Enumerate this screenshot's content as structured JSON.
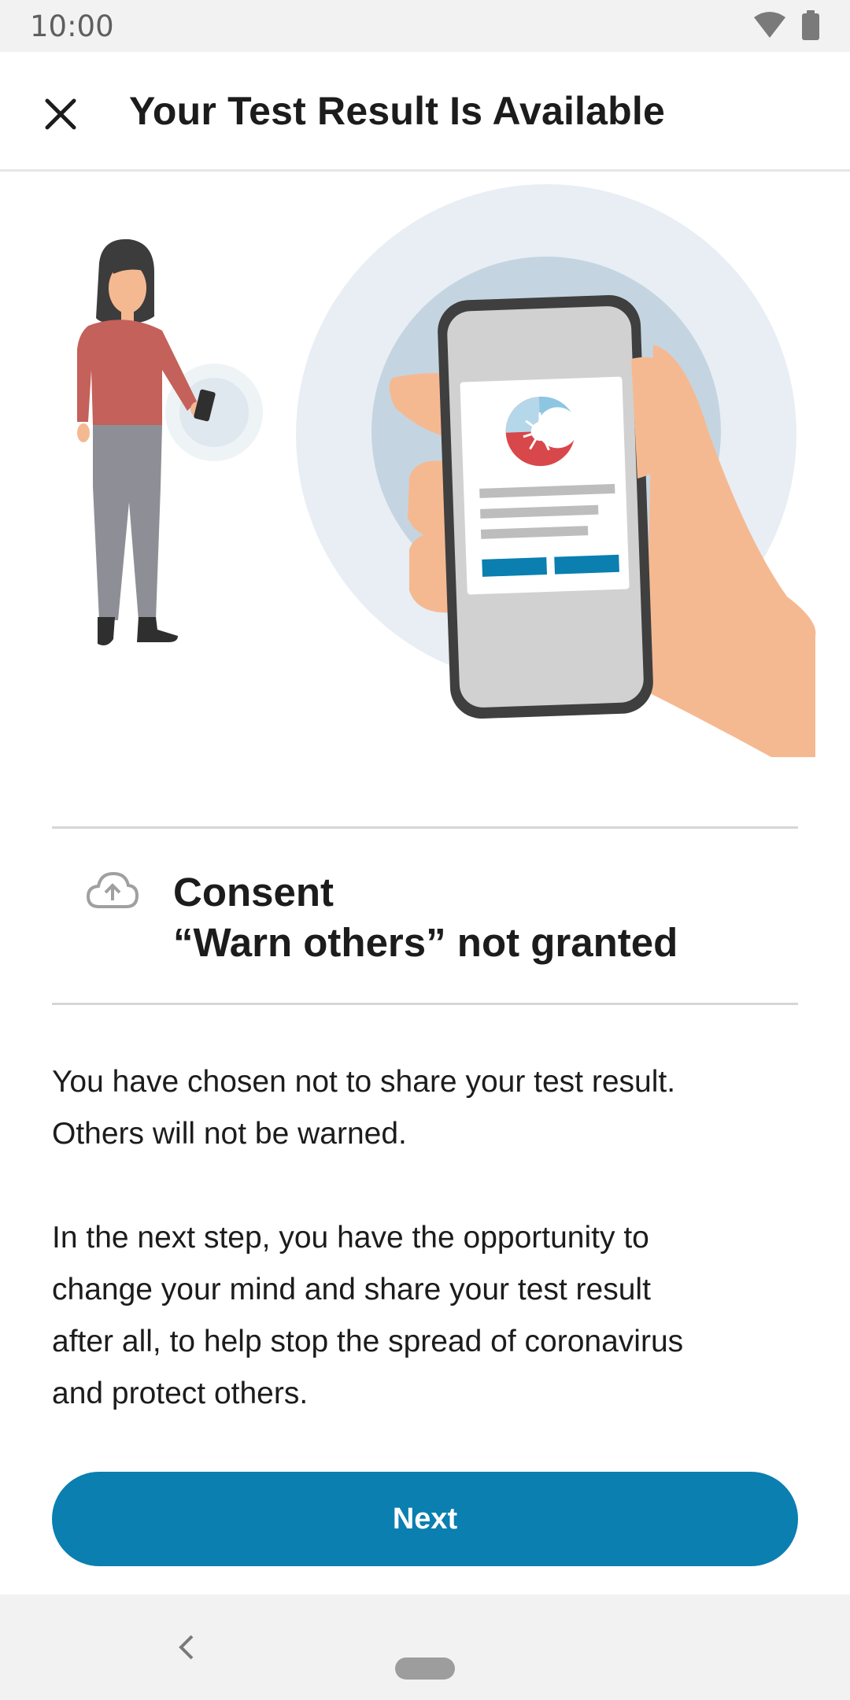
{
  "status_bar": {
    "time": "10:00",
    "icons": [
      "wifi-icon",
      "battery-icon"
    ]
  },
  "app_bar": {
    "close_icon": "close-icon",
    "title": "Your Test Result Is Available"
  },
  "consent": {
    "icon": "cloud-upload-icon",
    "line1": "Consent",
    "line2": "“Warn others” not granted"
  },
  "body": {
    "paragraph1_line1": "You have chosen not to share your test result.",
    "paragraph1_line2": "Others will not be warned.",
    "paragraph2_line1": "In the next step, you have the opportunity to",
    "paragraph2_line2": "change your mind and share your test result",
    "paragraph2_line3": "after all, to help stop the spread of coronavirus",
    "paragraph2_line4": "and protect others."
  },
  "actions": {
    "next_label": "Next"
  },
  "navigation": {
    "back_icon": "back-chevron-icon",
    "home_icon": "home-pill-icon"
  },
  "colors": {
    "accent": "#0a7fb0",
    "status_bar_bg": "#f2f2f2",
    "divider": "#d6d6d6"
  }
}
